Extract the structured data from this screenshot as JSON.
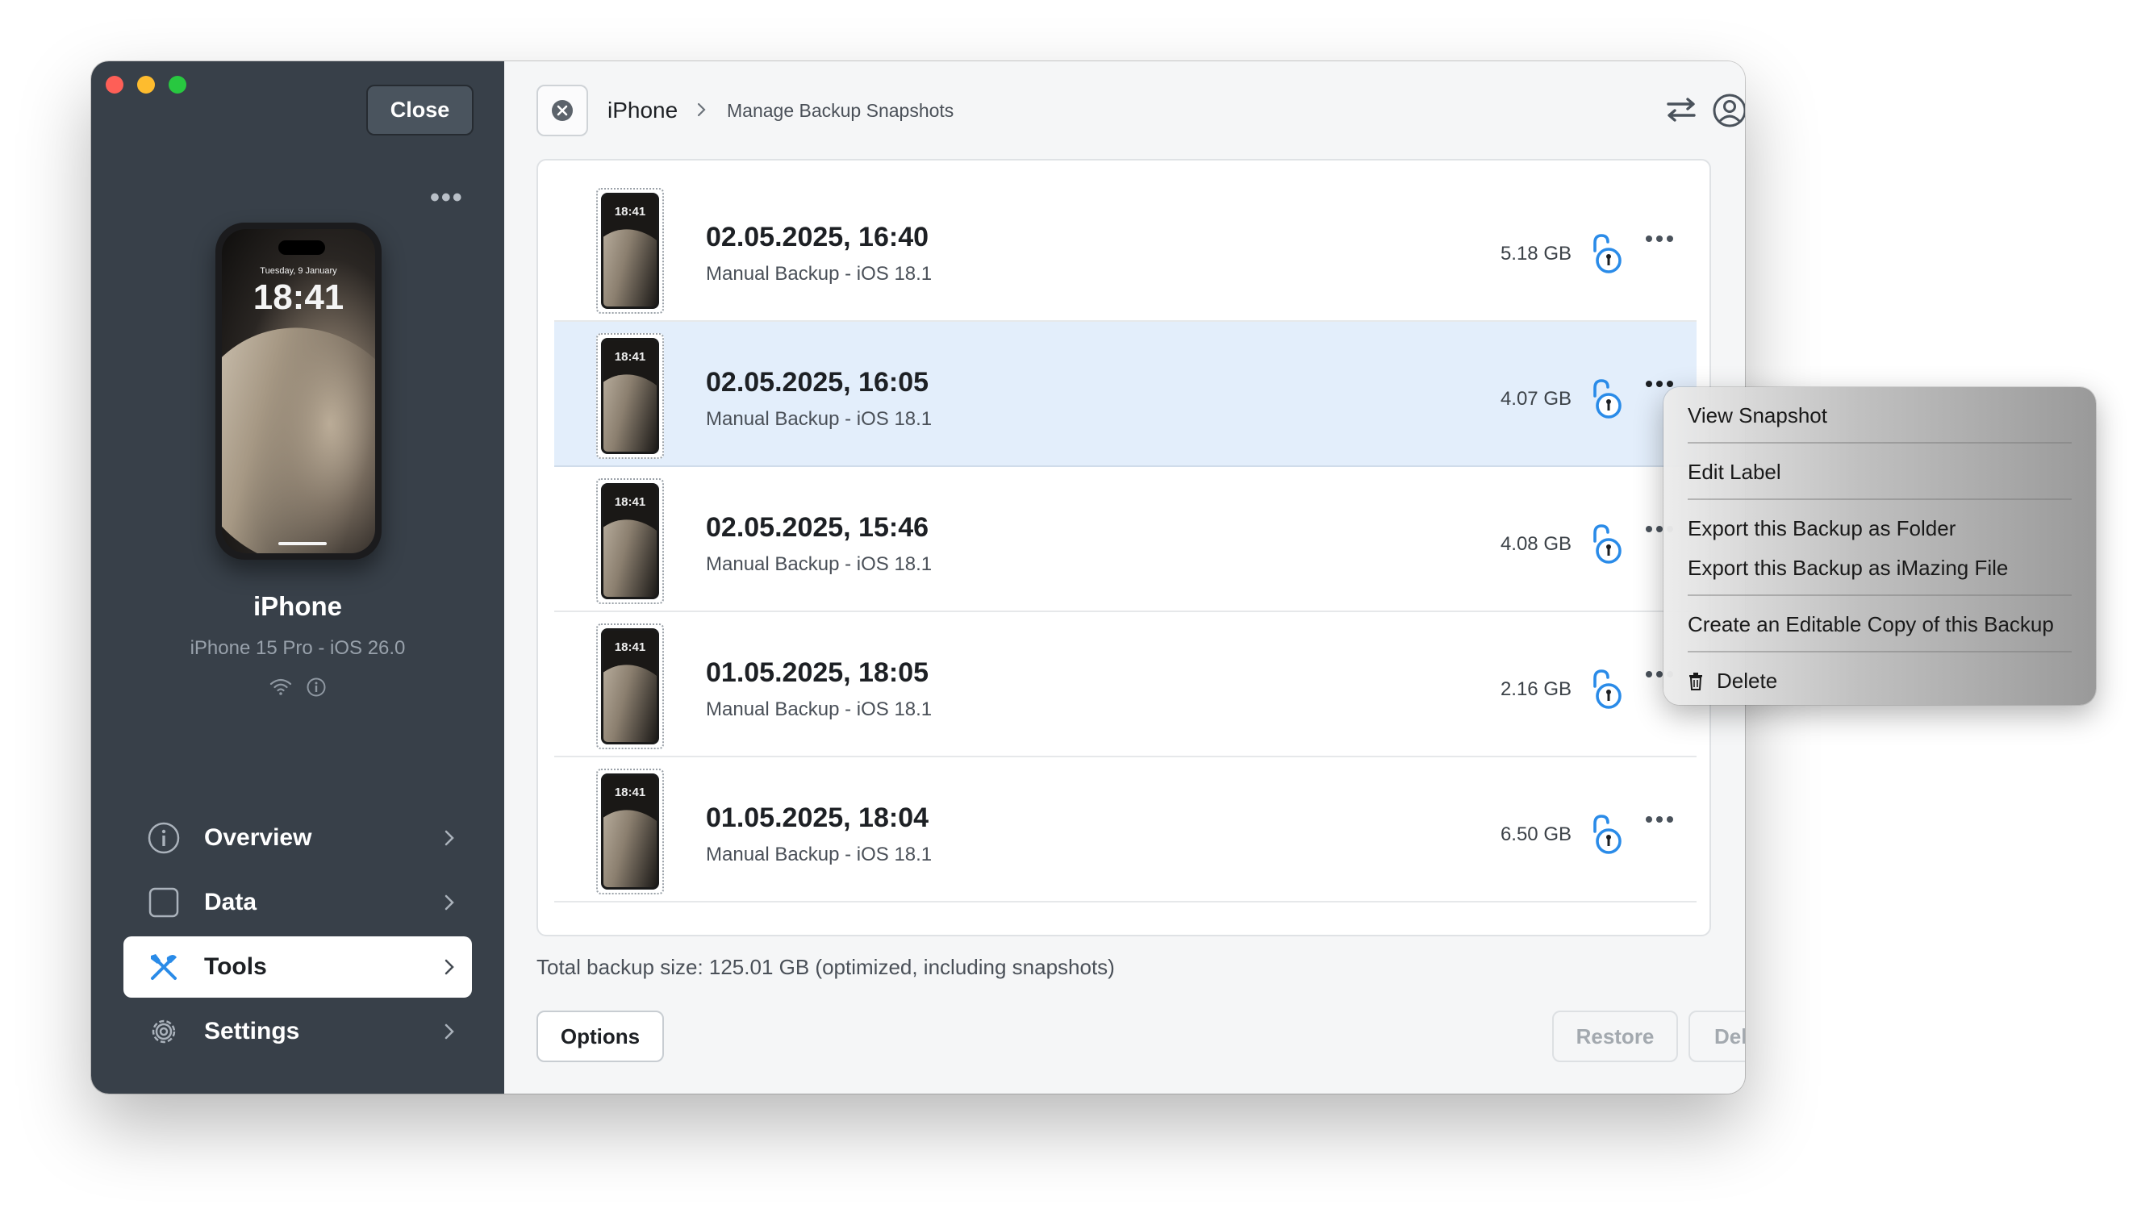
{
  "sidebar": {
    "close_label": "Close",
    "more_label": "•••",
    "device": {
      "phone_date": "Tuesday, 9 January",
      "phone_time": "18:41",
      "name": "iPhone",
      "model": "iPhone 15 Pro - iOS 26.0"
    },
    "nav": [
      {
        "label": "Overview",
        "icon": "info-circle-icon"
      },
      {
        "label": "Data",
        "icon": "square-icon"
      },
      {
        "label": "Tools",
        "icon": "tools-icon",
        "active": true
      },
      {
        "label": "Settings",
        "icon": "gear-icon"
      }
    ]
  },
  "header": {
    "breadcrumb_device": "iPhone",
    "breadcrumb_page": "Manage Backup Snapshots"
  },
  "backups": [
    {
      "title": "02.05.2025, 16:40",
      "subtitle": "Manual Backup - iOS 18.1",
      "size": "5.18 GB",
      "thumb_time": "18:41"
    },
    {
      "title": "02.05.2025, 16:05",
      "subtitle": "Manual Backup - iOS 18.1",
      "size": "4.07 GB",
      "thumb_time": "18:41",
      "selected": true
    },
    {
      "title": "02.05.2025, 15:46",
      "subtitle": "Manual Backup - iOS 18.1",
      "size": "4.08 GB",
      "thumb_time": "18:41"
    },
    {
      "title": "01.05.2025, 18:05",
      "subtitle": "Manual Backup - iOS 18.1",
      "size": "2.16 GB",
      "thumb_time": "18:41"
    },
    {
      "title": "01.05.2025, 18:04",
      "subtitle": "Manual Backup - iOS 18.1",
      "size": "6.50 GB",
      "thumb_time": "18:41"
    }
  ],
  "footer": {
    "total_text": "Total backup size: 125.01 GB (optimized, including snapshots)",
    "options_label": "Options",
    "restore_label": "Restore",
    "delete_label": "Delete"
  },
  "context_menu": {
    "view_snapshot": "View Snapshot",
    "edit_label": "Edit Label",
    "export_folder": "Export this Backup as Folder",
    "export_imazing": "Export this Backup as iMazing File",
    "create_copy": "Create an Editable Copy of this Backup",
    "delete": "Delete"
  },
  "colors": {
    "sidebar_bg": "#384049",
    "accent_blue": "#2a8be8",
    "selected_row": "#e3eefb"
  }
}
